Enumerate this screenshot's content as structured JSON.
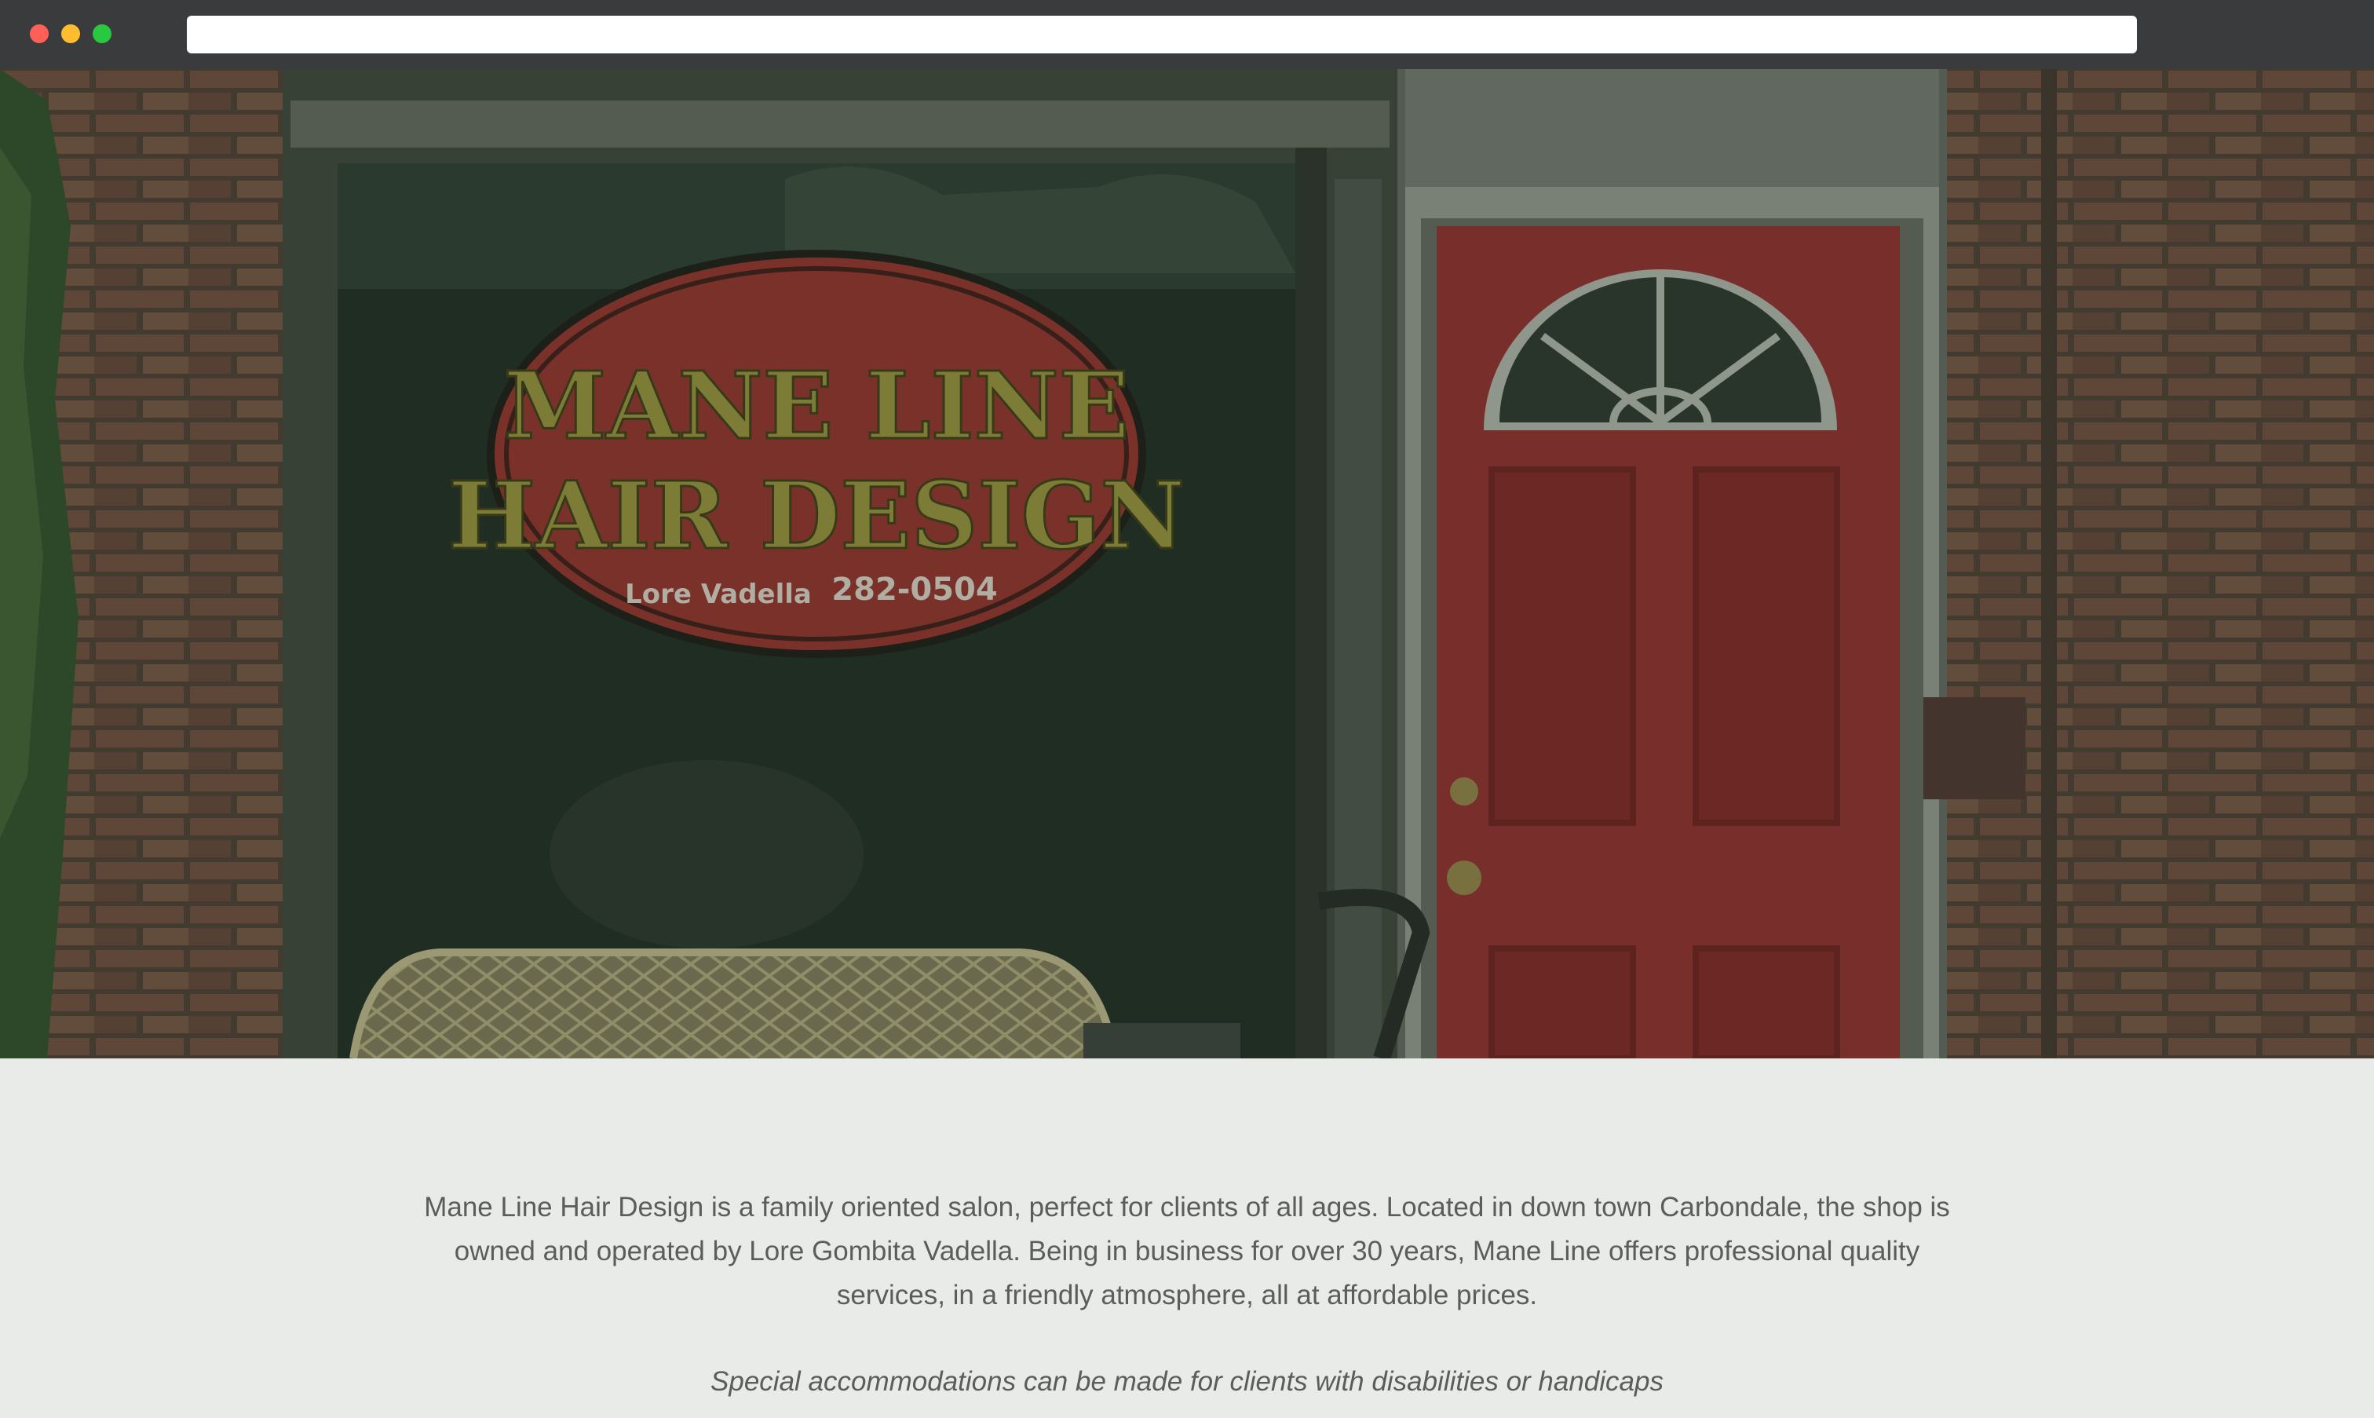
{
  "browser": {
    "url": ""
  },
  "hero": {
    "sign_line1": "MANE LINE",
    "sign_line2": "HAIR DESIGN",
    "sign_name": "Lore Vadella",
    "sign_phone": "282-0504",
    "colors": {
      "brick": "#6b4a3c",
      "door": "#8a2b2b",
      "sign_oval": "#8c2f2a",
      "sign_text": "#8f8a3a"
    }
  },
  "about": {
    "description": "Mane Line Hair Design is a family oriented salon, perfect for clients of all ages. Located in down town Carbondale, the shop is owned and operated by Lore Gombita Vadella. Being in business for over 30 years, Mane Line offers professional quality services, in a friendly atmosphere, all at affordable prices.",
    "accommodations_note": "Special accommodations can be made for clients with disabilities or handicaps"
  }
}
